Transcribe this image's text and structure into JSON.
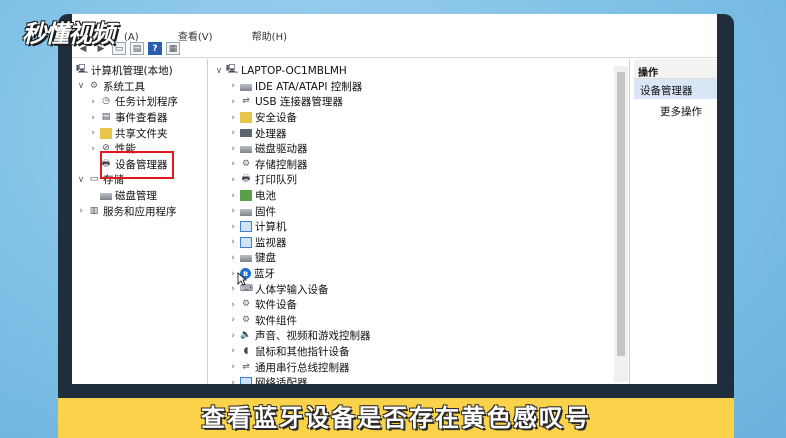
{
  "brand": {
    "logo_text": "秒懂视频"
  },
  "menu": {
    "items": [
      "(A)",
      "查看(V)",
      "帮助(H)"
    ]
  },
  "left_tree": {
    "root": "计算机管理(本地)",
    "system_tools": "系统工具",
    "task_scheduler": "任务计划程序",
    "event_viewer": "事件查看器",
    "shared_folders": "共享文件夹",
    "performance": "性能",
    "device_manager": "设备管理器",
    "storage": "存储",
    "disk_management": "磁盘管理",
    "services": "服务和应用程序"
  },
  "device_tree": {
    "computer_name": "LAPTOP-OC1MBLMH",
    "categories": [
      "IDE ATA/ATAPI 控制器",
      "USB 连接器管理器",
      "安全设备",
      "处理器",
      "磁盘驱动器",
      "存储控制器",
      "打印队列",
      "电池",
      "固件",
      "计算机",
      "监视器",
      "键盘",
      "蓝牙",
      "人体学输入设备",
      "软件设备",
      "软件组件",
      "声音、视频和游戏控制器",
      "鼠标和其他指针设备",
      "通用串行总线控制器",
      "网络适配器"
    ]
  },
  "actions": {
    "header": "操作",
    "selected": "设备管理器",
    "more": "更多操作"
  },
  "subtitle": {
    "text": "查看蓝牙设备是否存在黄色感叹号"
  },
  "colors": {
    "highlight": "#e3161d",
    "subtitle_bg": "#fbd34a",
    "frame": "#1f2d3d"
  }
}
